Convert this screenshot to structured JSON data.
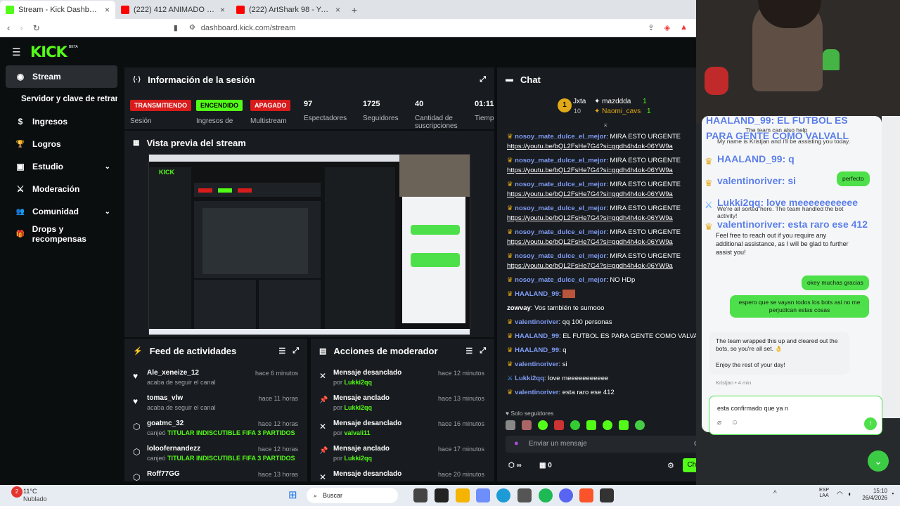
{
  "browser": {
    "tabs": [
      {
        "title": "Stream - Kick Dashboard",
        "active": true
      },
      {
        "title": "(222) 412 ANIMADO II CAPÍTULO 1 -",
        "active": false
      },
      {
        "title": "(222) ArtShark 98 - YouTube",
        "active": false
      }
    ],
    "url": "dashboard.kick.com/stream"
  },
  "app": {
    "logo": "KICK",
    "logo_tag": "BETA",
    "nav": [
      {
        "label": "Stream",
        "icon": "broadcast-icon",
        "glyph": "◉",
        "active": true
      },
      {
        "label": "Servidor y clave de retransn",
        "icon": "",
        "glyph": "",
        "active": false
      },
      {
        "label": "Ingresos",
        "icon": "dollar-icon",
        "glyph": "$",
        "active": false
      },
      {
        "label": "Logros",
        "icon": "trophy-icon",
        "glyph": "🏆",
        "active": false
      },
      {
        "label": "Estudio",
        "icon": "studio-icon",
        "glyph": "▣",
        "active": false,
        "expandable": true
      },
      {
        "label": "Moderación",
        "icon": "shield-icon",
        "glyph": "⚔",
        "active": false
      },
      {
        "label": "Comunidad",
        "icon": "people-icon",
        "glyph": "👥",
        "active": false,
        "expandable": true
      },
      {
        "label": "Drops y recompensas",
        "icon": "gift-icon",
        "glyph": "🎁",
        "active": false
      }
    ]
  },
  "session": {
    "title": "Información de la sesión",
    "stats": [
      {
        "value": "TRANSMITIENDO",
        "label": "Sesión",
        "kind": "badge-red"
      },
      {
        "value": "ENCENDIDO",
        "label": "Ingresos de",
        "kind": "badge-green"
      },
      {
        "value": "APAGADO",
        "label": "Multistream",
        "kind": "badge-red"
      },
      {
        "value": "97",
        "label": "Espectadores",
        "kind": "num"
      },
      {
        "value": "1725",
        "label": "Seguidores",
        "kind": "num"
      },
      {
        "value": "40",
        "label": "Cantidad de suscripciones",
        "kind": "num"
      },
      {
        "value": "01:11:",
        "label": "Tiemp",
        "kind": "num"
      }
    ]
  },
  "preview": {
    "title": "Vista previa del stream"
  },
  "feed": {
    "title": "Feed de actividades",
    "items": [
      {
        "icon": "heart-icon",
        "glyph": "♥",
        "name": "Ale_xeneize_12",
        "sub": "acaba de seguir el canal",
        "sub_highlight": "",
        "time": "hace 6 minutos"
      },
      {
        "icon": "heart-icon",
        "glyph": "♥",
        "name": "tomas_vlw",
        "sub": "acaba de seguir el canal",
        "sub_highlight": "",
        "time": "hace 11 horas"
      },
      {
        "icon": "points-icon",
        "glyph": "⬡",
        "name": "goatmc_32",
        "sub": "canjeó",
        "sub_highlight": "TITULAR INDISCUTIBLE FIFA 3 PARTIDOS",
        "time": "hace 12 horas"
      },
      {
        "icon": "points-icon",
        "glyph": "⬡",
        "name": "loloofernandezz",
        "sub": "canjeó",
        "sub_highlight": "TITULAR INDISCUTIBLE FIFA 3 PARTIDOS",
        "time": "hace 12 horas"
      },
      {
        "icon": "points-icon",
        "glyph": "⬡",
        "name": "Roff77GG",
        "sub": "",
        "sub_highlight": "",
        "time": "hace 13 horas"
      }
    ]
  },
  "modactions": {
    "title": "Acciones de moderador",
    "items": [
      {
        "icon": "unpin-icon",
        "glyph": "✕",
        "name": "Mensaje desanclado",
        "by": "Lukki2qq",
        "time": "hace 12 minutos"
      },
      {
        "icon": "pin-icon",
        "glyph": "📌",
        "name": "Mensaje anclado",
        "by": "Lukki2qq",
        "time": "hace 13 minutos"
      },
      {
        "icon": "unpin-icon",
        "glyph": "✕",
        "name": "Mensaje desanclado",
        "by": "valvali11",
        "time": "hace 16 minutos"
      },
      {
        "icon": "pin-icon",
        "glyph": "📌",
        "name": "Mensaje anclado",
        "by": "Lukki2qq",
        "time": "hace 17 minutos"
      },
      {
        "icon": "unpin-icon",
        "glyph": "✕",
        "name": "Mensaje desanclado",
        "by": "",
        "time": "hace 20 minutos"
      }
    ],
    "by_prefix": "por"
  },
  "chat": {
    "title": "Chat",
    "leaderboard": [
      {
        "name": "Jxta",
        "rank": "1",
        "count": ""
      },
      {
        "name": "mazddda",
        "rank": "",
        "count": "1"
      },
      {
        "name": "Naomi_cavs",
        "rank": "",
        "count": "1"
      }
    ],
    "leader_num": "10",
    "messages": [
      {
        "user": "nosoy_mate_dulce_el_mejor",
        "text": "MIRA ESTO URGENTE",
        "link": "https://youtu.be/bQL2FsHe7G4?si=ggdh4h4ok-06YW9a"
      },
      {
        "user": "nosoy_mate_dulce_el_mejor",
        "text": "MIRA ESTO URGENTE",
        "link": "https://youtu.be/bQL2FsHe7G4?si=ggdh4h4ok-06YW9a"
      },
      {
        "user": "nosoy_mate_dulce_el_mejor",
        "text": "MIRA ESTO URGENTE",
        "link": "https://youtu.be/bQL2FsHe7G4?si=ggdh4h4ok-06YW9a"
      },
      {
        "user": "nosoy_mate_dulce_el_mejor",
        "text": "MIRA ESTO URGENTE",
        "link": "https://youtu.be/bQL2FsHe7G4?si=ggdh4h4ok-06YW9a"
      },
      {
        "user": "nosoy_mate_dulce_el_mejor",
        "text": "MIRA ESTO URGENTE",
        "link": "https://youtu.be/bQL2FsHe7G4?si=ggdh4h4ok-06YW9a"
      },
      {
        "user": "nosoy_mate_dulce_el_mejor",
        "text": "MIRA ESTO URGENTE",
        "link": "https://youtu.be/bQL2FsHe7G4?si=ggdh4h4ok-06YW9a"
      },
      {
        "user": "nosoy_mate_dulce_el_mejor",
        "text": "NO HDp",
        "link": ""
      },
      {
        "user": "HAALAND_99",
        "text": "",
        "link": ""
      },
      {
        "user": "zowvay",
        "text": "Vos también te sumooo",
        "link": "",
        "plain_user": true
      },
      {
        "user": "valentinoriver",
        "text": "qq 100 personas",
        "link": ""
      },
      {
        "user": "HAALAND_99",
        "text": "EL FUTBOL ES PARA GENTE COMO VALVALL",
        "link": ""
      },
      {
        "user": "HAALAND_99",
        "text": "q",
        "link": ""
      },
      {
        "user": "valentinoriver",
        "text": "si",
        "link": ""
      },
      {
        "user": "Lukki2qq",
        "text": "love meeeeeeeeeee",
        "link": ""
      },
      {
        "user": "valentinoriver",
        "text": "esta raro ese 412",
        "link": ""
      }
    ],
    "followers_only": "Solo seguidores",
    "input_placeholder": "Enviar un mensaje",
    "points": "∞",
    "gifts": "0",
    "send_label": "Chat"
  },
  "support": {
    "overlay": [
      "HAALAND_99: EL FUTBOL ES",
      "PARA GENTE COMO VALVALL",
      "HAALAND_99: q",
      "valentinoriver: si",
      "Lukki2qq: love meeeeeeeeeee",
      "valentinoriver: esta raro ese 412"
    ],
    "msg_intro": "My name is Kristjan and I'll be assisting you today.",
    "team_help": "The team can also help",
    "perfecto": "perfecto",
    "sorted": "We're all sorted here. The team handled the bot activity!",
    "reach": "Feel free to reach out if you require any additional assistance, as I will be glad to further assist you!",
    "thanks": "okey muchas gracias",
    "hope": "espero que se vayan todos los bots asi no me perjudican estas cosas",
    "wrapped": "The team wrapped this up and cleared out the bots, so you're all set. 👌",
    "enjoy": "Enjoy the rest of your day!",
    "agent": "Kristjan • 4 min",
    "typing": "esta confirmado que ya n"
  },
  "taskbar": {
    "weather_temp": "11°C",
    "weather_desc": "Nublado",
    "search": "Buscar",
    "lang": "ESP",
    "lang2": "LAA",
    "time": "15:10",
    "date": "26/4/2026",
    "notif_count": "2"
  },
  "colors": {
    "kick_green": "#53fc18",
    "live_red": "#d81b1b",
    "chat_user": "#7f9cf5"
  }
}
